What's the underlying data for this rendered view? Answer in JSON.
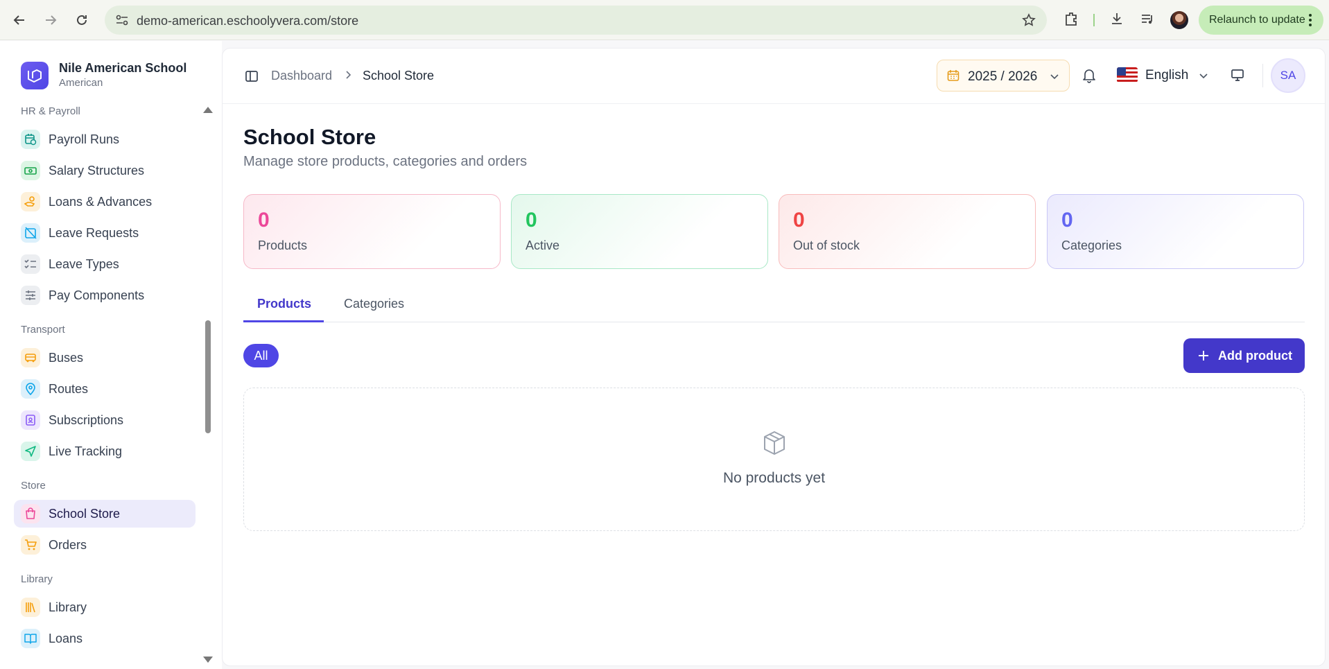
{
  "browser": {
    "url": "demo-american.eschoolyvera.com/store",
    "relaunch_label": "Relaunch to update"
  },
  "brand": {
    "name": "Nile American School",
    "subtitle": "American"
  },
  "sidebar": {
    "sections": [
      {
        "label": "HR & Payroll",
        "items": [
          {
            "label": "Payroll Runs",
            "icon": "calendar-clock-icon",
            "color": "#0d9488"
          },
          {
            "label": "Salary Structures",
            "icon": "banknote-icon",
            "color": "#16a34a"
          },
          {
            "label": "Loans & Advances",
            "icon": "hand-coins-icon",
            "color": "#f59e0b"
          },
          {
            "label": "Leave Requests",
            "icon": "calendar-off-icon",
            "color": "#0ea5e9"
          },
          {
            "label": "Leave Types",
            "icon": "list-checks-icon",
            "color": "#6b7280"
          },
          {
            "label": "Pay Components",
            "icon": "sliders-icon",
            "color": "#6b7280"
          }
        ]
      },
      {
        "label": "Transport",
        "items": [
          {
            "label": "Buses",
            "icon": "bus-icon",
            "color": "#f59e0b"
          },
          {
            "label": "Routes",
            "icon": "map-pin-icon",
            "color": "#0ea5e9"
          },
          {
            "label": "Subscriptions",
            "icon": "id-badge-icon",
            "color": "#8b5cf6"
          },
          {
            "label": "Live Tracking",
            "icon": "navigation-icon",
            "color": "#10b981"
          }
        ]
      },
      {
        "label": "Store",
        "items": [
          {
            "label": "School Store",
            "icon": "shopping-bag-icon",
            "color": "#ec4899",
            "active": true
          },
          {
            "label": "Orders",
            "icon": "shopping-cart-icon",
            "color": "#f59e0b"
          }
        ]
      },
      {
        "label": "Library",
        "items": [
          {
            "label": "Library",
            "icon": "library-icon",
            "color": "#f59e0b"
          },
          {
            "label": "Loans",
            "icon": "book-open-icon",
            "color": "#0ea5e9"
          }
        ]
      }
    ]
  },
  "header": {
    "breadcrumb": [
      "Dashboard",
      "School Store"
    ],
    "academic_year": "2025 / 2026",
    "language": "English",
    "user_initials": "SA"
  },
  "page": {
    "title": "School Store",
    "subtitle": "Manage store products, categories and orders"
  },
  "stats": [
    {
      "value": "0",
      "label": "Products",
      "accent": "#ec4899"
    },
    {
      "value": "0",
      "label": "Active",
      "accent": "#22c55e"
    },
    {
      "value": "0",
      "label": "Out of stock",
      "accent": "#ef4444"
    },
    {
      "value": "0",
      "label": "Categories",
      "accent": "#6366f1"
    }
  ],
  "tabs": [
    {
      "label": "Products",
      "active": true
    },
    {
      "label": "Categories",
      "active": false
    }
  ],
  "filter": {
    "all_label": "All"
  },
  "actions": {
    "add_product_label": "Add product"
  },
  "empty_state": {
    "message": "No products yet"
  },
  "colors": {
    "primary": "#4f46e5",
    "active_nav_bg": "#ecebfb"
  }
}
